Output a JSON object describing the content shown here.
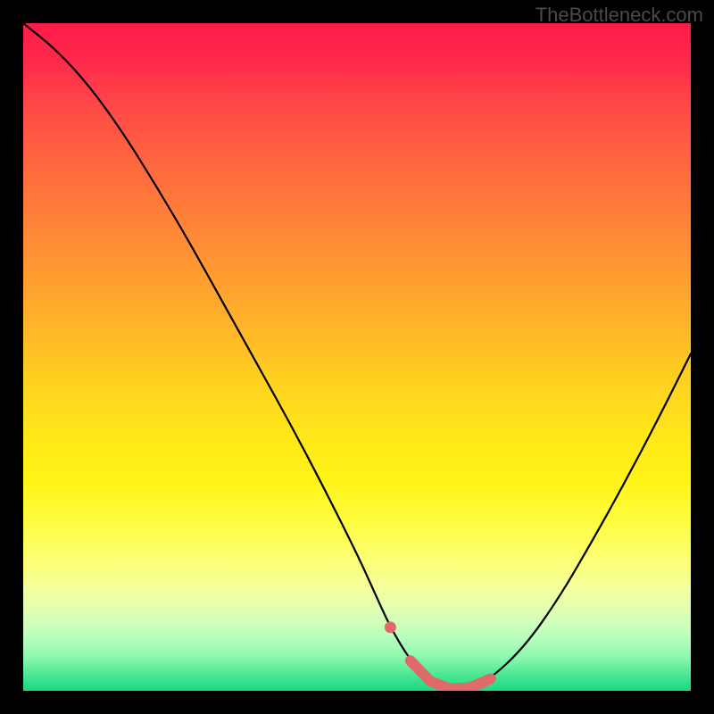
{
  "watermark": "TheBottleneck.com",
  "colors": {
    "highlight": "#e06a6a",
    "curve": "#000000"
  },
  "chart_data": {
    "type": "line",
    "title": "",
    "xlabel": "",
    "ylabel": "",
    "xlim": [
      0,
      100
    ],
    "ylim": [
      0,
      100
    ],
    "x": [
      0,
      5,
      10,
      15,
      20,
      25,
      30,
      35,
      40,
      45,
      50,
      52.5,
      55,
      58,
      61,
      64,
      67,
      70,
      75,
      80,
      85,
      90,
      95,
      100
    ],
    "values": [
      100,
      96,
      90.5,
      83.5,
      75.5,
      67,
      58,
      49,
      40,
      30.5,
      20.5,
      15,
      9.5,
      4.5,
      1.4,
      0.3,
      0.5,
      1.8,
      6.5,
      13.5,
      22,
      31,
      40.5,
      50.5
    ],
    "valley": {
      "x_range": [
        55,
        70
      ],
      "min_x": 64,
      "min_value": 0.3,
      "left_marker": {
        "x": 55,
        "value": 9.5
      },
      "highlight_points": [
        {
          "x": 58,
          "value": 4.5
        },
        {
          "x": 61,
          "value": 1.4
        },
        {
          "x": 64,
          "value": 0.3
        },
        {
          "x": 67,
          "value": 0.5
        },
        {
          "x": 70,
          "value": 1.8
        }
      ]
    },
    "background_gradient": {
      "stops": [
        {
          "pos": 0,
          "color": "#ff1a4a"
        },
        {
          "pos": 50,
          "color": "#ffd21f"
        },
        {
          "pos": 100,
          "color": "#18d884"
        }
      ]
    }
  }
}
